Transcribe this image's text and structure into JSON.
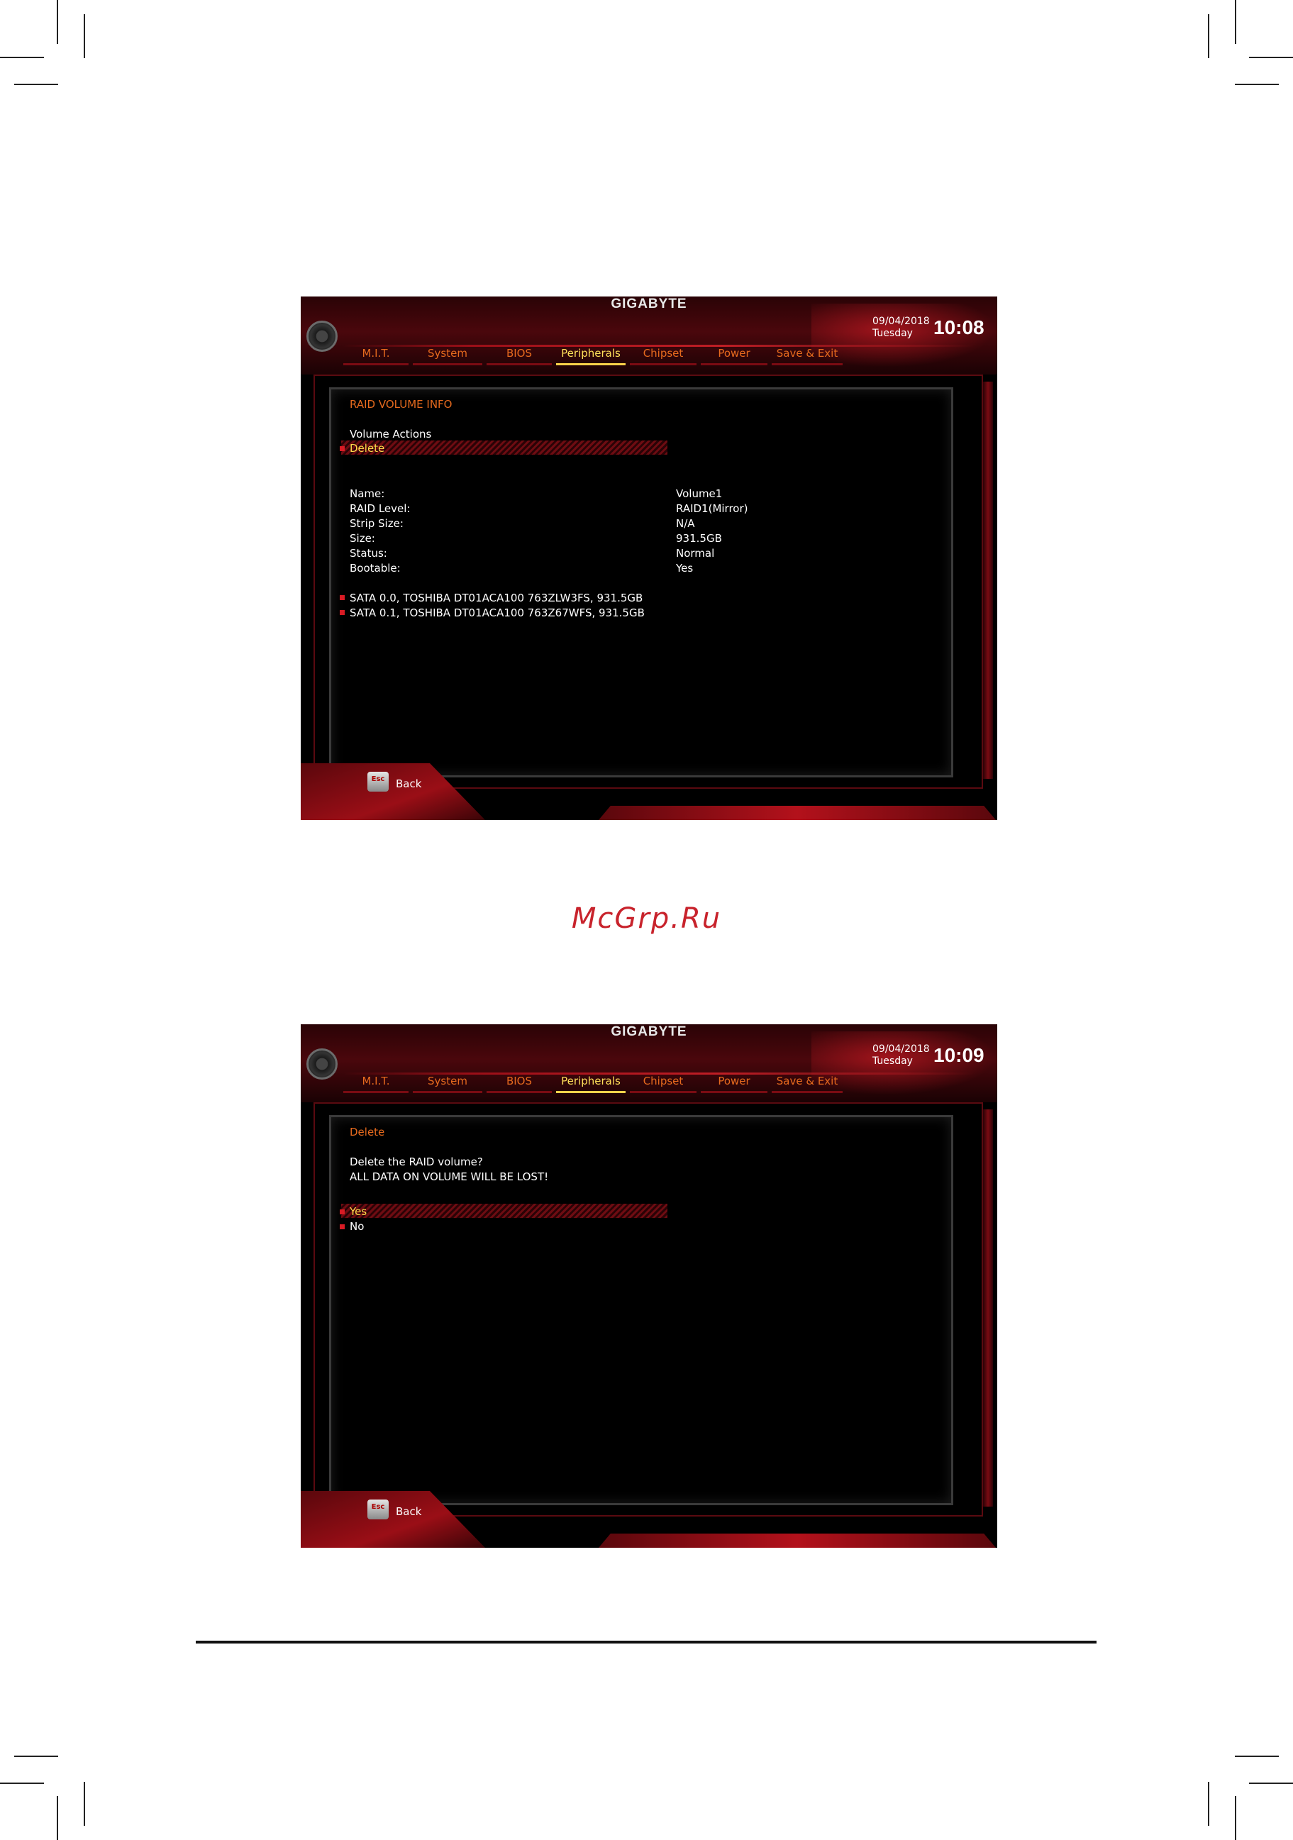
{
  "watermark": "McGrp.Ru",
  "screens": {
    "first": {
      "brand": "GIGABYTE",
      "date": "09/04/2018",
      "day": "Tuesday",
      "time": "10:08",
      "tabs": [
        "M.I.T.",
        "System",
        "BIOS",
        "Peripherals",
        "Chipset",
        "Power",
        "Save & Exit"
      ],
      "active_tab": "Peripherals",
      "title": "RAID VOLUME INFO",
      "section_label": "Volume Actions",
      "selected_item": "Delete",
      "info_labels": [
        "Name:",
        "RAID Level:",
        "Strip Size:",
        "Size:",
        "Status:",
        "Bootable:"
      ],
      "info_values": [
        "Volume1",
        "RAID1(Mirror)",
        "N/A",
        "931.5GB",
        "Normal",
        "Yes"
      ],
      "disks": [
        "SATA 0.0, TOSHIBA DT01ACA100 763ZLW3FS, 931.5GB",
        "SATA 0.1, TOSHIBA DT01ACA100 763Z67WFS, 931.5GB"
      ],
      "esc_key": "Esc",
      "back_label": "Back"
    },
    "second": {
      "brand": "GIGABYTE",
      "date": "09/04/2018",
      "day": "Tuesday",
      "time": "10:09",
      "tabs": [
        "M.I.T.",
        "System",
        "BIOS",
        "Peripherals",
        "Chipset",
        "Power",
        "Save & Exit"
      ],
      "active_tab": "Peripherals",
      "title": "Delete",
      "prompt_line1": "Delete the RAID volume?",
      "prompt_line2": "ALL DATA ON VOLUME WILL BE LOST!",
      "options": [
        "Yes",
        "No"
      ],
      "selected_option": "Yes",
      "esc_key": "Esc",
      "back_label": "Back"
    }
  }
}
